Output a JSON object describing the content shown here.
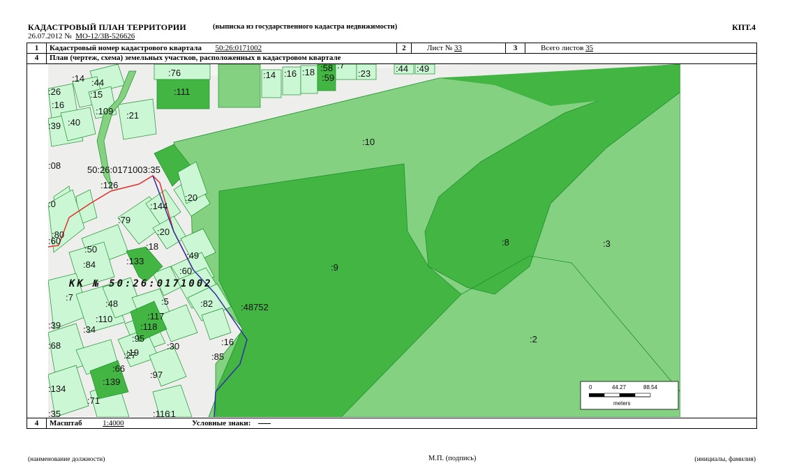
{
  "header": {
    "title": "КАДАСТРОВЫЙ ПЛАН ТЕРРИТОРИИ",
    "subtitle": "(выписка из государственного кадастра недвижимости)",
    "form_code": "КПТ.4",
    "date": "26.07.2012 №",
    "doc_number": "МО-12/3В-526626"
  },
  "row1": {
    "n1": "1",
    "label": "Кадастровый номер кадастрового квартала",
    "cadastral_number": "50:26:0171002",
    "n2": "2",
    "sheet_label": "Лист №",
    "sheet_value": "33",
    "n3": "3",
    "total_label": "Всего листов",
    "total_value": "35"
  },
  "row2": {
    "n": "4",
    "label": "План (чертеж, схема) земельных участков, расположенных в кадастровом квартале"
  },
  "map": {
    "quarter_label": "КК № 50:26:0171002",
    "boundary_label": "50:26:0171003:35",
    "parcel_labels": [
      ":76",
      ":111",
      ":14",
      ":16",
      ":18",
      ":58",
      ":7",
      ":23",
      ":44",
      ":49",
      ":59",
      ":44",
      ":14",
      ":15",
      ":26",
      ":16",
      ":109",
      ":21",
      ":39",
      ":40",
      ":10",
      ":8",
      ":3",
      ":126",
      ":20",
      ":144",
      ":79",
      ":20",
      ":80",
      ":50",
      ":18",
      ":133",
      ":84",
      ":49",
      ":60",
      ":9",
      ":8",
      ":3",
      ":7",
      ":48",
      ":5",
      ":82",
      ":48752",
      ":39",
      ":110",
      ":34",
      ":117",
      ":118",
      ":95",
      ":68",
      ":19",
      ":30",
      ":16",
      ":27",
      ":85",
      ":2",
      ":66",
      ":97",
      ":139",
      ":134",
      ":71",
      ":116",
      ":1",
      ":35",
      ":08",
      ":0",
      ":60"
    ],
    "scale_bar": {
      "ticks": [
        "0",
        "44.27",
        "88.54"
      ],
      "unit": "meters"
    }
  },
  "row3": {
    "n": "4",
    "scale_label": "Масштаб",
    "scale_value": "1:4000",
    "legend_label": "Условные знаки:"
  },
  "footer": {
    "position": "(наименование должности)",
    "stamp": "М.П. (подпись)",
    "initials": "(инициалы, фамилия)"
  },
  "colors": {
    "light_parcel": "#ccf7d4",
    "medium_parcel": "#83d181",
    "dark_parcel": "#43b543",
    "mid_parcel": "#5cc45a",
    "outline": "#1e8f2e",
    "quarter_boundary": "#e03030",
    "blue_boundary": "#3030a0"
  }
}
